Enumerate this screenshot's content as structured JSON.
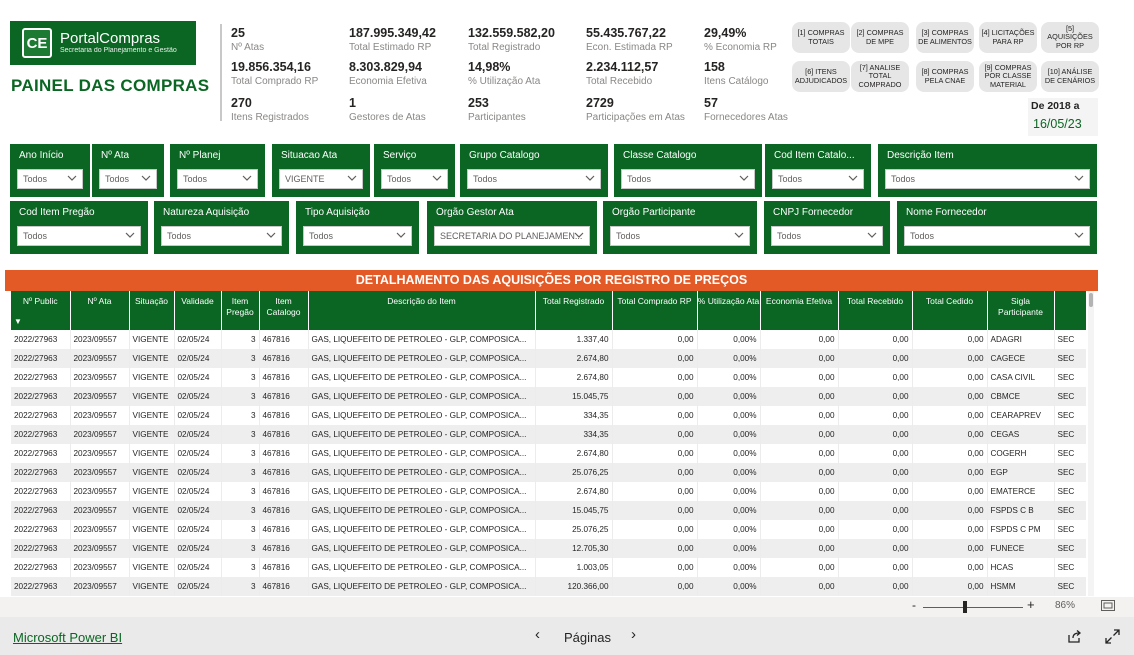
{
  "header": {
    "logo_emblem": "CE",
    "logo_title": "PortalCompras",
    "logo_subtitle": "Secretaria do Planejamento e Gestão",
    "panel_title": "PAINEL DAS COMPRAS",
    "date_label": "De 2018 a",
    "date_value": "16/05/23"
  },
  "kpis": [
    {
      "value": "25",
      "label": "Nº Atas"
    },
    {
      "value": "187.995.349,42",
      "label": "Total Estimado RP"
    },
    {
      "value": "132.559.582,20",
      "label": "Total Registrado"
    },
    {
      "value": "55.435.767,22",
      "label": "Econ. Estimada RP"
    },
    {
      "value": "29,49%",
      "label": "% Economia RP"
    },
    {
      "value": "19.856.354,16",
      "label": "Total Comprado RP"
    },
    {
      "value": "8.303.829,94",
      "label": "Economia Efetiva"
    },
    {
      "value": "14,98%",
      "label": "% Utilização Ata"
    },
    {
      "value": "2.234.112,57",
      "label": "Total Recebido"
    },
    {
      "value": "158",
      "label": "Itens Catálogo"
    },
    {
      "value": "270",
      "label": "Itens Registrados"
    },
    {
      "value": "1",
      "label": "Gestores de Atas"
    },
    {
      "value": "253",
      "label": "Participantes"
    },
    {
      "value": "2729",
      "label": "Participações em Atas"
    },
    {
      "value": "57",
      "label": "Fornecedores Atas"
    }
  ],
  "nav_buttons": [
    "[1] COMPRAS TOTAIS",
    "[2] COMPRAS DE MPE",
    "[3] COMPRAS DE ALIMENTOS",
    "[4] LICITAÇÕES PARA RP",
    "[5] AQUISIÇÕES POR RP",
    "[6] ITENS ADJUDICADOS",
    "[7] ANALISE TOTAL COMPRADO",
    "[8] COMPRAS PELA CNAE",
    "[9] COMPRAS POR CLASSE MATERIAL",
    "[10] ANÁLISE DE CENÁRIOS"
  ],
  "slicers_row1": [
    {
      "label": "Ano Início",
      "value": "Todos"
    },
    {
      "label": "Nº Ata",
      "value": "Todos"
    },
    {
      "label": "Nº Planej",
      "value": "Todos"
    },
    {
      "label": "Situacao Ata",
      "value": "VIGENTE"
    },
    {
      "label": "Serviço",
      "value": "Todos"
    },
    {
      "label": "Grupo Catalogo",
      "value": "Todos"
    },
    {
      "label": "Classe Catalogo",
      "value": "Todos"
    },
    {
      "label": "Cod Item Catalo...",
      "value": "Todos"
    },
    {
      "label": "Descrição Item",
      "value": "Todos"
    }
  ],
  "slicers_row2": [
    {
      "label": "Cod Item Pregão",
      "value": "Todos"
    },
    {
      "label": "Natureza Aquisição",
      "value": "Todos"
    },
    {
      "label": "Tipo Aquisição",
      "value": "Todos"
    },
    {
      "label": "Órgão Gestor Ata",
      "value": "SECRETARIA DO PLANEJAMEN..."
    },
    {
      "label": "Órgão Participante",
      "value": "Todos"
    },
    {
      "label": "CNPJ Fornecedor",
      "value": "Todos"
    },
    {
      "label": "Nome Fornecedor",
      "value": "Todos"
    }
  ],
  "table": {
    "title": "DETALHAMENTO DAS AQUISIÇÕES POR REGISTRO DE PREÇOS",
    "columns": [
      "Nº Public",
      "Nº Ata",
      "Situação",
      "Validade",
      "Item Pregão",
      "Item Catalogo",
      "Descrição do Item",
      "Total Registrado",
      "Total Comprado RP",
      "% Utilização Ata",
      "Economia Efetiva",
      "Total Recebido",
      "Total Cedido",
      "Sigla Participante",
      ""
    ],
    "sort_indicator": "▼",
    "rows": [
      [
        "2022/27963",
        "2023/09557",
        "VIGENTE",
        "02/05/24",
        "3",
        "467816",
        "GAS, LIQUEFEITO DE PETROLEO - GLP, COMPOSICA...",
        "1.337,40",
        "0,00",
        "0,00%",
        "0,00",
        "0,00",
        "0,00",
        "ADAGRI",
        "SEC"
      ],
      [
        "2022/27963",
        "2023/09557",
        "VIGENTE",
        "02/05/24",
        "3",
        "467816",
        "GAS, LIQUEFEITO DE PETROLEO - GLP, COMPOSICA...",
        "2.674,80",
        "0,00",
        "0,00%",
        "0,00",
        "0,00",
        "0,00",
        "CAGECE",
        "SEC"
      ],
      [
        "2022/27963",
        "2023/09557",
        "VIGENTE",
        "02/05/24",
        "3",
        "467816",
        "GAS, LIQUEFEITO DE PETROLEO - GLP, COMPOSICA...",
        "2.674,80",
        "0,00",
        "0,00%",
        "0,00",
        "0,00",
        "0,00",
        "CASA CIVIL",
        "SEC"
      ],
      [
        "2022/27963",
        "2023/09557",
        "VIGENTE",
        "02/05/24",
        "3",
        "467816",
        "GAS, LIQUEFEITO DE PETROLEO - GLP, COMPOSICA...",
        "15.045,75",
        "0,00",
        "0,00%",
        "0,00",
        "0,00",
        "0,00",
        "CBMCE",
        "SEC"
      ],
      [
        "2022/27963",
        "2023/09557",
        "VIGENTE",
        "02/05/24",
        "3",
        "467816",
        "GAS, LIQUEFEITO DE PETROLEO - GLP, COMPOSICA...",
        "334,35",
        "0,00",
        "0,00%",
        "0,00",
        "0,00",
        "0,00",
        "CEARAPREV",
        "SEC"
      ],
      [
        "2022/27963",
        "2023/09557",
        "VIGENTE",
        "02/05/24",
        "3",
        "467816",
        "GAS, LIQUEFEITO DE PETROLEO - GLP, COMPOSICA...",
        "334,35",
        "0,00",
        "0,00%",
        "0,00",
        "0,00",
        "0,00",
        "CEGAS",
        "SEC"
      ],
      [
        "2022/27963",
        "2023/09557",
        "VIGENTE",
        "02/05/24",
        "3",
        "467816",
        "GAS, LIQUEFEITO DE PETROLEO - GLP, COMPOSICA...",
        "2.674,80",
        "0,00",
        "0,00%",
        "0,00",
        "0,00",
        "0,00",
        "COGERH",
        "SEC"
      ],
      [
        "2022/27963",
        "2023/09557",
        "VIGENTE",
        "02/05/24",
        "3",
        "467816",
        "GAS, LIQUEFEITO DE PETROLEO - GLP, COMPOSICA...",
        "25.076,25",
        "0,00",
        "0,00%",
        "0,00",
        "0,00",
        "0,00",
        "EGP",
        "SEC"
      ],
      [
        "2022/27963",
        "2023/09557",
        "VIGENTE",
        "02/05/24",
        "3",
        "467816",
        "GAS, LIQUEFEITO DE PETROLEO - GLP, COMPOSICA...",
        "2.674,80",
        "0,00",
        "0,00%",
        "0,00",
        "0,00",
        "0,00",
        "EMATERCE",
        "SEC"
      ],
      [
        "2022/27963",
        "2023/09557",
        "VIGENTE",
        "02/05/24",
        "3",
        "467816",
        "GAS, LIQUEFEITO DE PETROLEO - GLP, COMPOSICA...",
        "15.045,75",
        "0,00",
        "0,00%",
        "0,00",
        "0,00",
        "0,00",
        "FSPDS C B",
        "SEC"
      ],
      [
        "2022/27963",
        "2023/09557",
        "VIGENTE",
        "02/05/24",
        "3",
        "467816",
        "GAS, LIQUEFEITO DE PETROLEO - GLP, COMPOSICA...",
        "25.076,25",
        "0,00",
        "0,00%",
        "0,00",
        "0,00",
        "0,00",
        "FSPDS C PM",
        "SEC"
      ],
      [
        "2022/27963",
        "2023/09557",
        "VIGENTE",
        "02/05/24",
        "3",
        "467816",
        "GAS, LIQUEFEITO DE PETROLEO - GLP, COMPOSICA...",
        "12.705,30",
        "0,00",
        "0,00%",
        "0,00",
        "0,00",
        "0,00",
        "FUNECE",
        "SEC"
      ],
      [
        "2022/27963",
        "2023/09557",
        "VIGENTE",
        "02/05/24",
        "3",
        "467816",
        "GAS, LIQUEFEITO DE PETROLEO - GLP, COMPOSICA...",
        "1.003,05",
        "0,00",
        "0,00%",
        "0,00",
        "0,00",
        "0,00",
        "HCAS",
        "SEC"
      ],
      [
        "2022/27963",
        "2023/09557",
        "VIGENTE",
        "02/05/24",
        "3",
        "467816",
        "GAS, LIQUEFEITO DE PETROLEO - GLP, COMPOSICA...",
        "120.366,00",
        "0,00",
        "0,00%",
        "0,00",
        "0,00",
        "0,00",
        "HSMM",
        "SEC"
      ]
    ]
  },
  "zoom": {
    "minus": "-",
    "plus": "+",
    "percent": "86%"
  },
  "footer": {
    "powerbi_link": "Microsoft Power BI",
    "pages_label": "Páginas",
    "prev": "‹",
    "next": "›"
  },
  "colors": {
    "brand_green": "#0b6623",
    "table_title_orange": "#e35a26"
  }
}
